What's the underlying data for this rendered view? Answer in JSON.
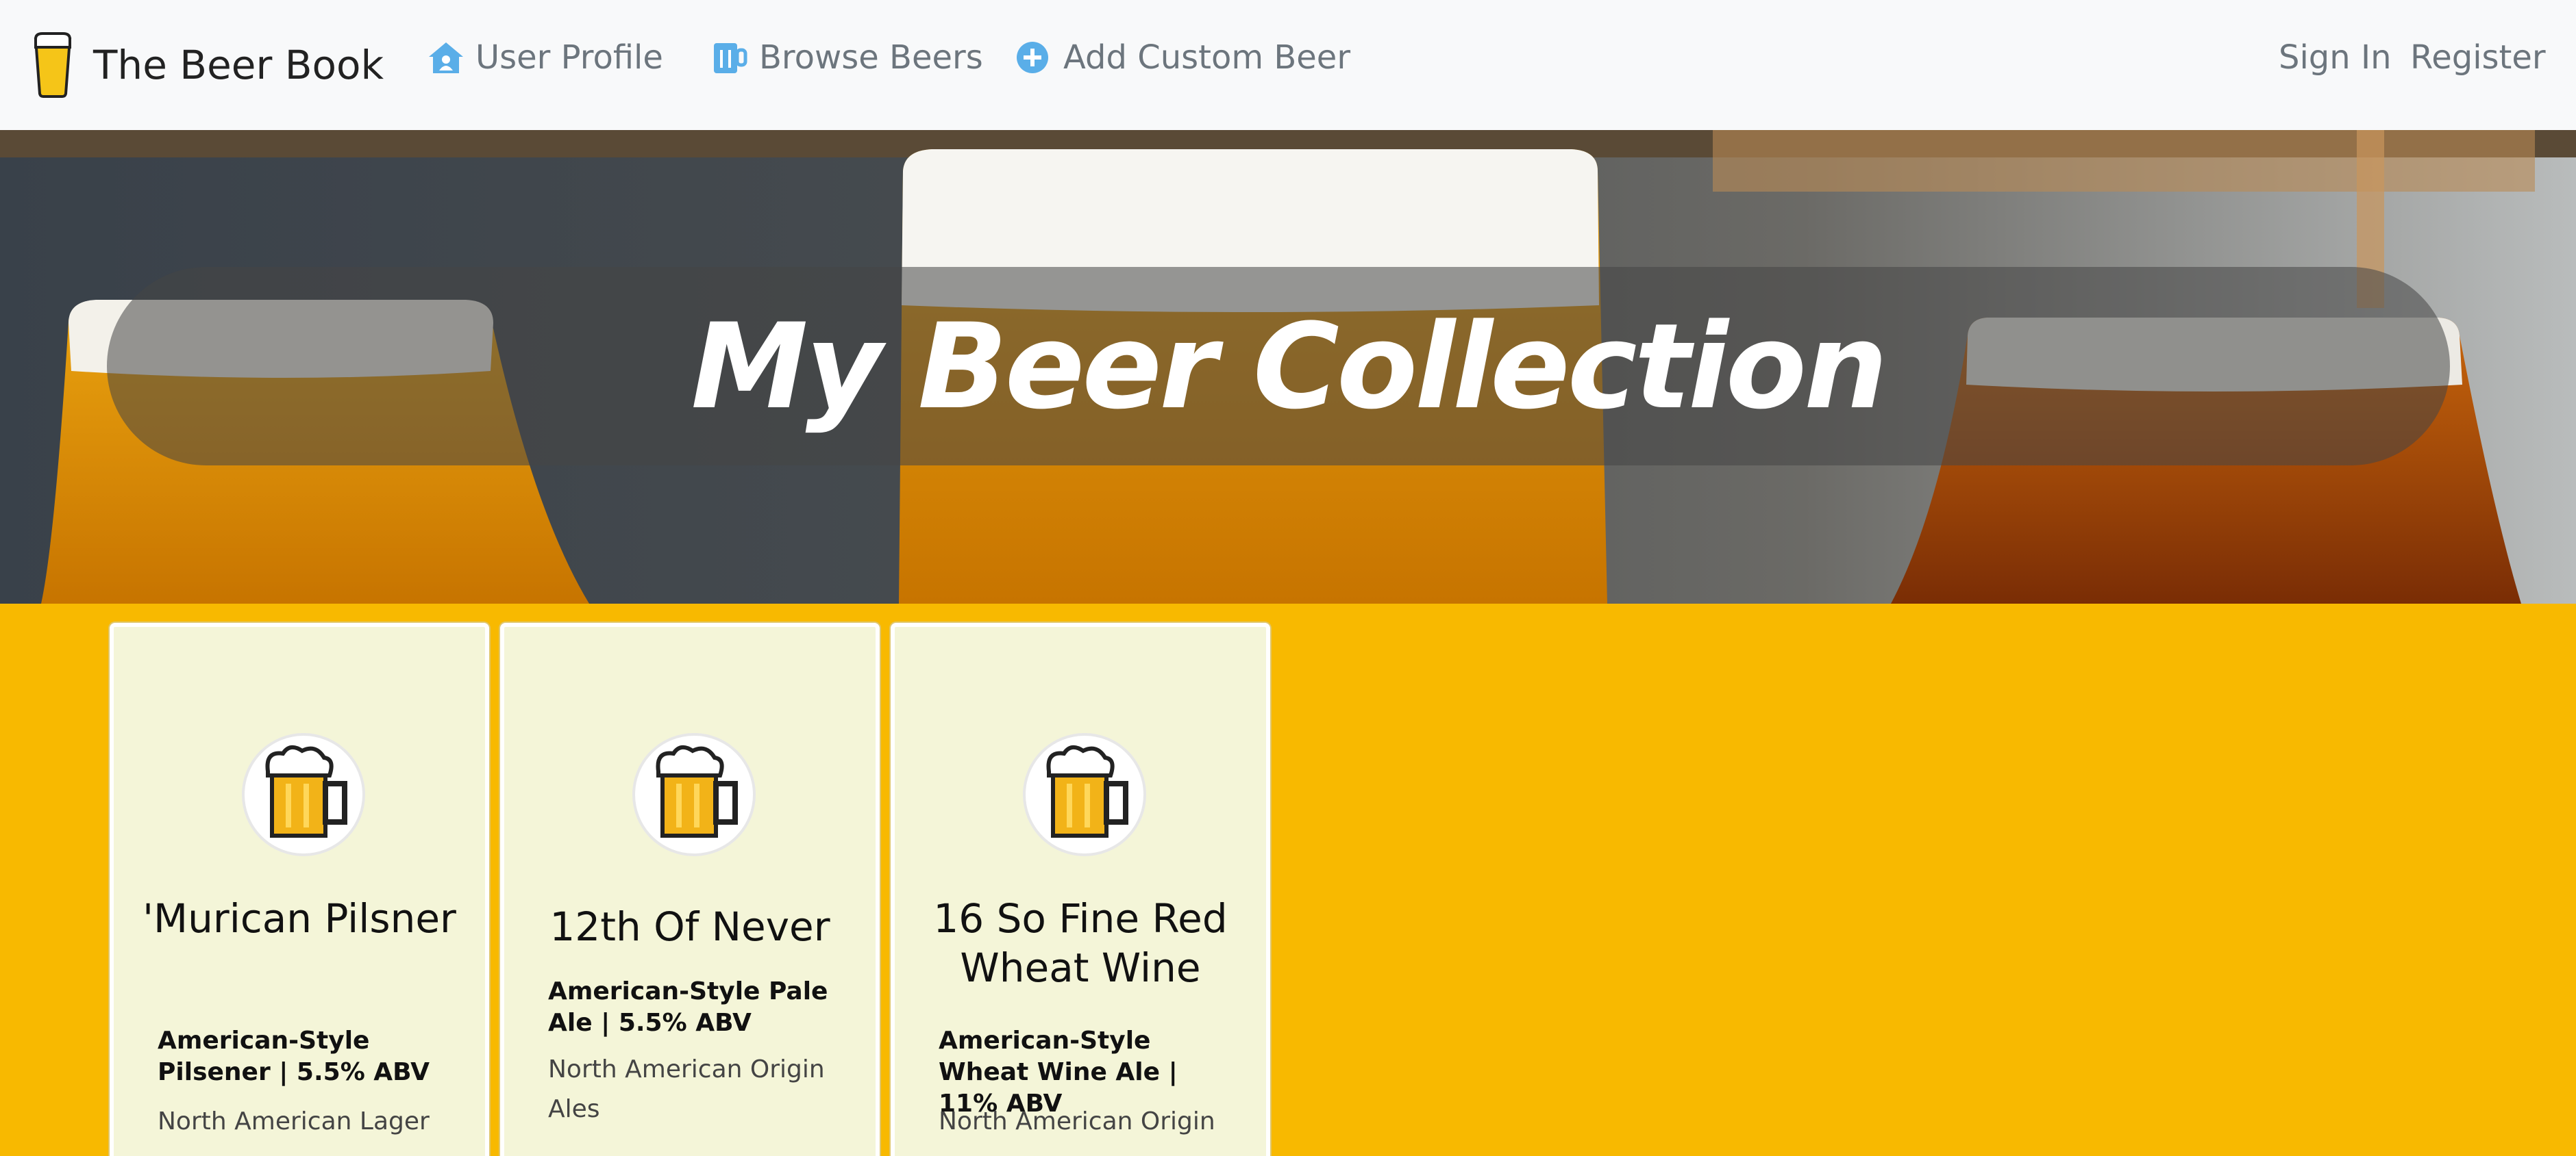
{
  "navbar": {
    "brand": "The Beer Book",
    "links": [
      {
        "label": "User Profile",
        "icon": "house-user-icon"
      },
      {
        "label": "Browse Beers",
        "icon": "beer-mug-icon"
      },
      {
        "label": "Add Custom Beer",
        "icon": "plus-circle-icon"
      }
    ],
    "sign_in": "Sign In",
    "register": "Register"
  },
  "hero": {
    "title": "My Beer Collection"
  },
  "cards": [
    {
      "title": "'Murican Pilsner",
      "style": "American-Style Pilsener | 5.5% ABV",
      "category": "North American Lager"
    },
    {
      "title": "12th Of Never",
      "style": "American-Style Pale Ale | 5.5% ABV",
      "category": "North American Origin Ales"
    },
    {
      "title": "16 So Fine Red Wheat Wine",
      "style": "American-Style Wheat Wine Ale | 11% ABV",
      "category": "North American Origin"
    }
  ],
  "colors": {
    "page_background": "#f8b900",
    "navbar_background": "#f8f9fa",
    "card_background": "#f4f5d8",
    "icon_blue": "#5aaee8"
  }
}
